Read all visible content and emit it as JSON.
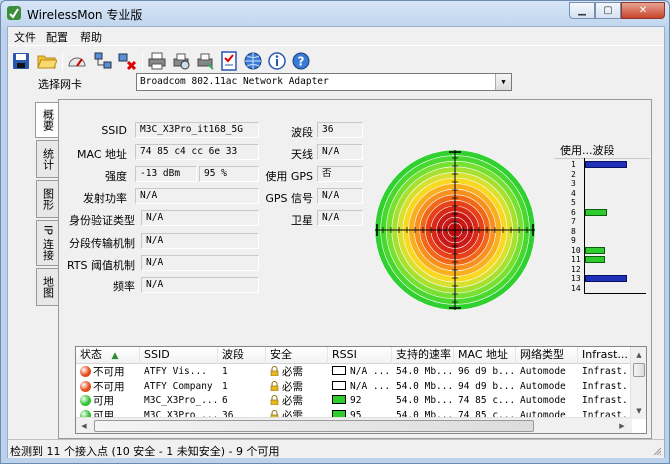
{
  "window": {
    "title": "WirelessMon 专业版"
  },
  "menu": {
    "file": "文件",
    "config": "配置",
    "help": "帮助"
  },
  "toolbar": {
    "icons": [
      "save-icon",
      "open-folder-icon",
      "gauge-icon",
      "network-icon",
      "disconnect-icon",
      "print-icon",
      "print-preview-icon",
      "print-setup-icon",
      "checklist-icon",
      "globe-icon",
      "info-icon",
      "help-icon"
    ]
  },
  "adapter": {
    "label": "选择网卡",
    "value": "Broadcom 802.11ac Network Adapter"
  },
  "tabs": [
    "概要",
    "统计",
    "图形",
    "IP 连接",
    "地图"
  ],
  "fields": {
    "ssid_label": "SSID",
    "ssid": "M3C_X3Pro_it168_5G",
    "mac_label": "MAC 地址",
    "mac": "74 85 c4 cc 6e 33",
    "strength_label": "强度",
    "strength_dbm": "-13 dBm",
    "strength_pct": "95 %",
    "txpower_label": "发射功率",
    "txpower": "N/A",
    "auth_label": "身份验证类型",
    "auth": "N/A",
    "frag_label": "分段传输机制",
    "frag": "N/A",
    "rts_label": "RTS 阈值机制",
    "rts": "N/A",
    "freq_label": "频率",
    "freq": "N/A",
    "channel_label": "波段",
    "channel": "36",
    "antenna_label": "天线",
    "antenna": "N/A",
    "gps_label": "使用 GPS",
    "gps": "否",
    "gps_signal_label": "GPS 信号",
    "gps_signal": "N/A",
    "satellite_label": "卫星",
    "satellite": "N/A"
  },
  "usage": {
    "title": "使用...波段",
    "channels": [
      "1",
      "2",
      "3",
      "4",
      "5",
      "6",
      "7",
      "8",
      "9",
      "10",
      "11",
      "12",
      "13",
      "14"
    ],
    "colors": {
      "blue": "#1f2fb8",
      "green": "#2ecc2e"
    }
  },
  "table": {
    "columns": [
      "状态",
      "SSID",
      "波段",
      "安全",
      "RSSI",
      "支持的速率",
      "MAC 地址",
      "网络类型",
      "Infrast..."
    ],
    "sort_icon": "sort-up-icon",
    "rows": [
      {
        "status": "不可用",
        "color": "#e04a1a",
        "ssid": "ATFY  Vis...",
        "channel": "1",
        "security": "必需",
        "rssi": "N/A ...",
        "rssi_color": "#ffffff",
        "rates": "54.0 Mb...",
        "mac": "96 d9 b...",
        "type": "Automode",
        "infra": "Infrast..."
      },
      {
        "status": "不可用",
        "color": "#e04a1a",
        "ssid": "ATFY  Company",
        "channel": "1",
        "security": "必需",
        "rssi": "N/A ...",
        "rssi_color": "#ffffff",
        "rates": "54.0 Mb...",
        "mac": "94 d9 b...",
        "type": "Automode",
        "infra": "Infrast..."
      },
      {
        "status": "可用",
        "color": "#2ec22e",
        "ssid": "M3C_X3Pro_...",
        "channel": "6",
        "security": "必需",
        "rssi": "92",
        "rssi_color": "#2ecc2e",
        "rates": "54.0 Mb...",
        "mac": "74 85 c...",
        "type": "Automode",
        "infra": "Infrast..."
      },
      {
        "status": "可用",
        "color": "#2ec22e",
        "ssid": "M3C_X3Pro_...",
        "channel": "36",
        "security": "必需",
        "rssi": "95",
        "rssi_color": "#2ecc2e",
        "rates": "54.0 Mb...",
        "mac": "74 85 c...",
        "type": "Automode",
        "infra": "Infrast..."
      }
    ]
  },
  "status": {
    "text": "检测到 11 个接入点 (10 安全 - 1 未知安全) - 9 个可用"
  }
}
